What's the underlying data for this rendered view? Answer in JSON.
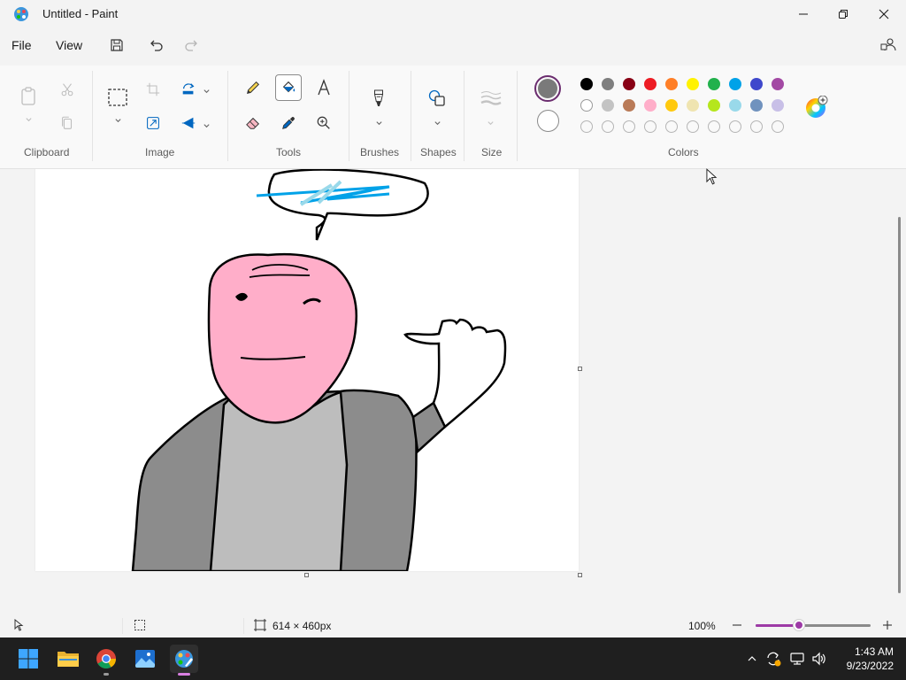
{
  "window": {
    "title": "Untitled - Paint"
  },
  "menu": {
    "file": "File",
    "view": "View"
  },
  "ribbon": {
    "groups": {
      "clipboard": "Clipboard",
      "image": "Image",
      "tools": "Tools",
      "brushes": "Brushes",
      "shapes": "Shapes",
      "size": "Size",
      "colors": "Colors"
    },
    "primary_color": "#7a7a7a",
    "secondary_color": "#ffffff",
    "palette_row1": [
      "#000000",
      "#7f7f7f",
      "#880015",
      "#ed1c24",
      "#ff7f27",
      "#fff200",
      "#22b14c",
      "#00a2e8",
      "#3f48cc",
      "#a349a4"
    ],
    "palette_row2": [
      "#ffffff",
      "#c3c3c3",
      "#b97a57",
      "#ffaec9",
      "#ffc90e",
      "#efe4b0",
      "#b5e61d",
      "#99d9ea",
      "#7092be",
      "#c8bfe7"
    ],
    "palette_row3_empty_count": 10
  },
  "status": {
    "canvas_size": "614 × 460px",
    "zoom": "100%",
    "zoom_fraction": 0.38
  },
  "taskbar": {
    "time": "1:43 AM",
    "date": "9/23/2022"
  }
}
